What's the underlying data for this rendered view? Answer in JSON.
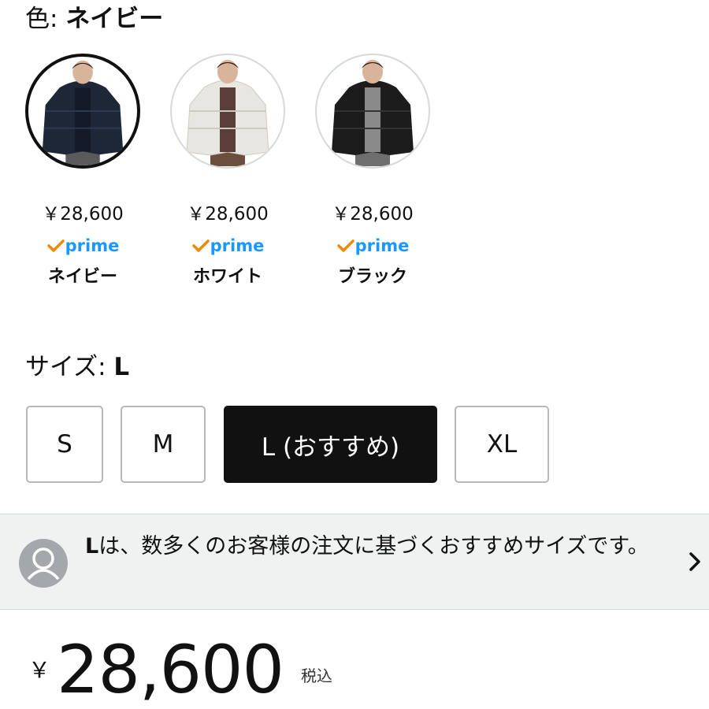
{
  "color_selector": {
    "label": "色: ",
    "selected_value": "ネイビー",
    "options": [
      {
        "name": "ネイビー",
        "price": "￥28,600",
        "prime_label": "prime",
        "selected": true,
        "jacket_color": "#1d2738",
        "inner_color": "#141a26",
        "pants_color": "#5a5a5a"
      },
      {
        "name": "ホワイト",
        "price": "￥28,600",
        "prime_label": "prime",
        "selected": false,
        "jacket_color": "#e8e6e0",
        "inner_color": "#5a3d38",
        "pants_color": "#6b4e3d"
      },
      {
        "name": "ブラック",
        "price": "￥28,600",
        "prime_label": "prime",
        "selected": false,
        "jacket_color": "#1c1c1c",
        "inner_color": "#8a8a8a",
        "pants_color": "#6e6e6e"
      }
    ]
  },
  "size_selector": {
    "label": "サイズ: ",
    "selected_value": "L",
    "options": [
      {
        "label": "S",
        "selected": false
      },
      {
        "label": "M",
        "selected": false
      },
      {
        "label": "L (おすすめ)",
        "selected": true
      },
      {
        "label": "XL",
        "selected": false
      }
    ]
  },
  "recommendation": {
    "bold": "L",
    "text": "は、数多くのお客様の注文に基づくおすすめサイズです。"
  },
  "price": {
    "currency": "￥",
    "amount": "28,600",
    "tax_label": "税込"
  },
  "colors": {
    "prime_blue": "#1a98ff",
    "prime_orange": "#f08804",
    "selected_bg": "#111111",
    "banner_bg": "#f0f2f2"
  }
}
